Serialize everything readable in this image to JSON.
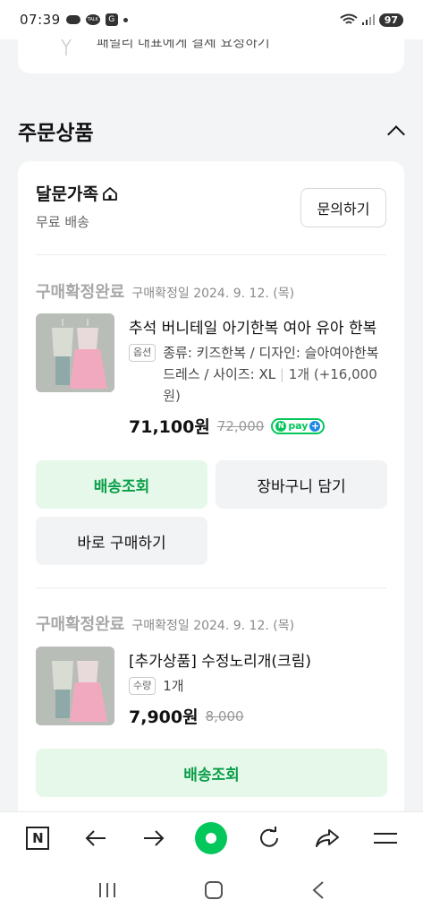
{
  "status_bar": {
    "time": "07:39",
    "battery": "97",
    "talk_icon_text": "TALK",
    "app_icon_text": "G"
  },
  "top_card": {
    "text": "패밀리 대표에게 결제 요청하기"
  },
  "section": {
    "title": "주문상품"
  },
  "store": {
    "name": "달문가족",
    "shipping": "무료 배송",
    "inquiry_label": "문의하기"
  },
  "items": [
    {
      "status": "구매확정완료",
      "confirm_date": "구매확정일 2024. 9. 12. (목)",
      "title": "추석 버니테일 아기한복 여아 유아 한복",
      "option_badge": "옵션",
      "option_text": "종류: 키즈한복 / 디자인: 슬아여아한복드레스 / 사이즈: XL",
      "option_qty": "1개 (+16,000원)",
      "price": "71,100원",
      "original_price": "72,000",
      "npay_label": "pay",
      "buttons": {
        "track": "배송조회",
        "cart": "장바구니 담기",
        "buy_now": "바로 구매하기"
      }
    },
    {
      "status": "구매확정완료",
      "confirm_date": "구매확정일 2024. 9. 12. (목)",
      "title": "[추가상품] 수정노리개(크림)",
      "option_badge": "수량",
      "option_text": "1개",
      "price": "7,900원",
      "original_price": "8,000",
      "buttons": {
        "track": "배송조회"
      }
    }
  ],
  "colors": {
    "accent_green": "#03c75a",
    "button_green_bg": "#e5f8ea",
    "button_green_text": "#0a9e48",
    "npay_plus_blue": "#1e88e5"
  },
  "browser_bar": {
    "icons": [
      "naver-n-icon",
      "back-arrow-icon",
      "forward-arrow-icon",
      "home-green-dot-icon",
      "refresh-icon",
      "share-icon",
      "menu-icon"
    ],
    "n_label": "N"
  },
  "system_nav": {
    "icons": [
      "recent-apps-icon",
      "home-icon",
      "back-icon"
    ]
  }
}
